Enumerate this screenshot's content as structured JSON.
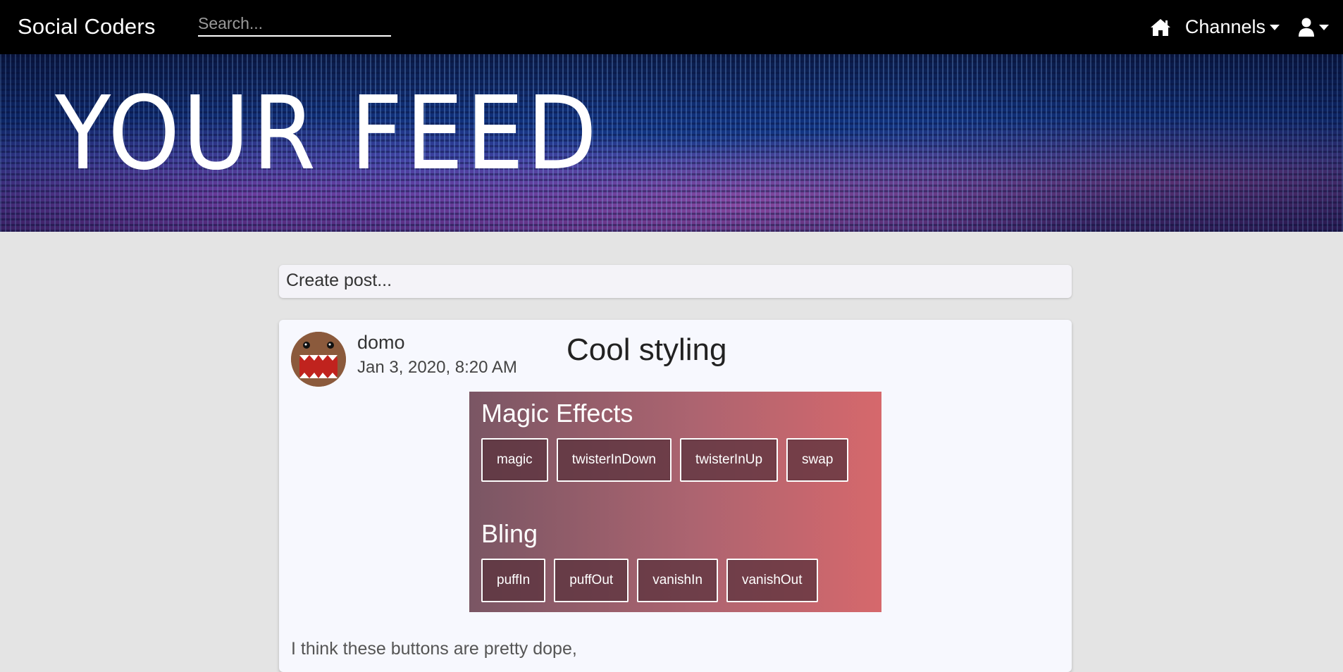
{
  "navbar": {
    "brand": "Social Coders",
    "search_placeholder": "Search...",
    "home_icon": "home-icon",
    "channels_label": "Channels",
    "user_icon": "user-icon"
  },
  "hero": {
    "title": "YOUR FEED"
  },
  "create_post": {
    "placeholder": "Create post..."
  },
  "post": {
    "author": "domo",
    "date": "Jan 3, 2020, 8:20 AM",
    "title": "Cool styling",
    "embed": {
      "sections": [
        {
          "heading": "Magic Effects",
          "buttons": [
            "magic",
            "twisterInDown",
            "twisterInUp",
            "swap"
          ]
        },
        {
          "heading": "Bling",
          "buttons": [
            "puffIn",
            "puffOut",
            "vanishIn",
            "vanishOut"
          ]
        }
      ]
    },
    "body_lines": [
      "I think these buttons are pretty dope,"
    ]
  }
}
